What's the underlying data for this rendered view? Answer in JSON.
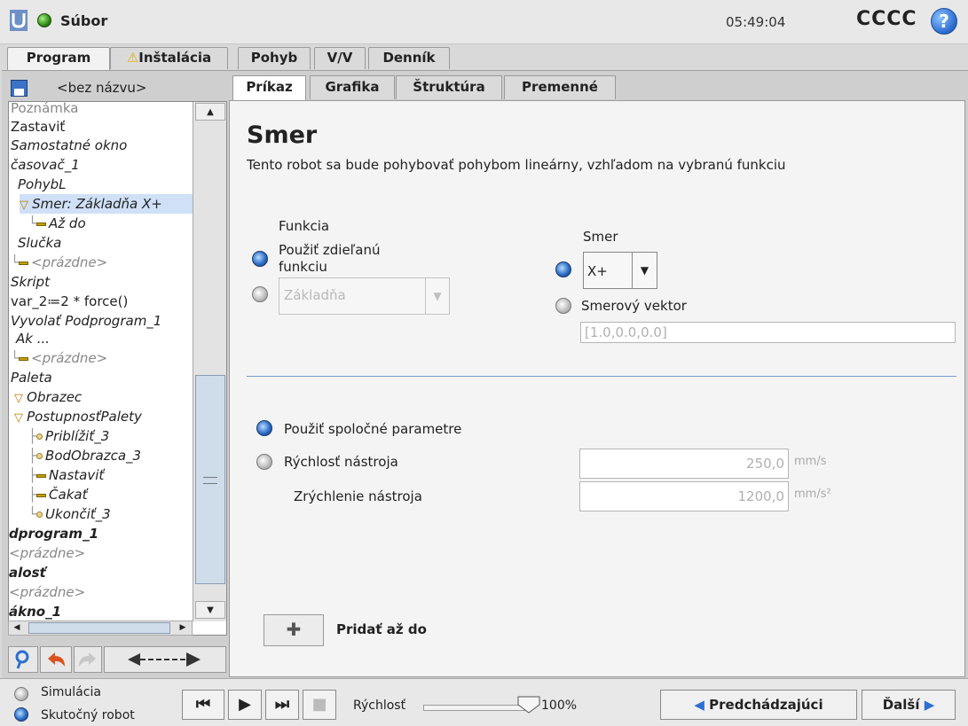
{
  "header": {
    "file_label": "Súbor",
    "clock": "05:49:04",
    "robot_name": "CCCC",
    "help_symbol": "?"
  },
  "main_tabs": [
    {
      "label": "Program",
      "active": true
    },
    {
      "label": "Inštalácia",
      "warning": "⚠"
    },
    {
      "label": "Pohyb"
    },
    {
      "label": "V/V"
    },
    {
      "label": "Denník"
    }
  ],
  "program": {
    "name": "<bez názvu>"
  },
  "tree": [
    "Poznámka",
    "Zastaviť",
    "Samostatné okno",
    "časovač_1",
    "PohybL",
    "Smer: Základňa X+",
    "Až do",
    "Slučka",
    "<prázdne>",
    "Skript",
    "var_2≔2 * force()",
    "Vyvolať Podprogram_1",
    "Ak ...",
    "<prázdne>",
    "Paleta",
    "Obrazec",
    "PostupnosťPalety",
    "Priblížiť_3",
    "BodObrazca_3",
    "Nastaviť",
    "Čakať",
    "Ukončiť_3",
    "dprogram_1",
    "<prázdne>",
    "alosť",
    "<prázdne>",
    "ákno_1"
  ],
  "sub_tabs": [
    {
      "label": "Príkaz",
      "active": true
    },
    {
      "label": "Grafika"
    },
    {
      "label": "Štruktúra"
    },
    {
      "label": "Premenné"
    }
  ],
  "panel": {
    "title": "Smer",
    "description": "Tento robot sa bude pohybovať pohybom lineárny, vzhľadom na vybranú funkciu",
    "feature_label": "Funkcia",
    "use_shared_feature": "Použiť zdieľanú funkciu",
    "feature_value": "Základňa",
    "direction_label": "Smer",
    "direction_value": "X+",
    "direction_vector_label": "Smerový vektor",
    "direction_vector_value": "[1.0,0.0,0.0]",
    "use_common_params": "Použiť spoločné parametre",
    "tool_speed_label": "Rýchlosť nástroja",
    "tool_speed_value": "250,0",
    "tool_speed_unit": "mm/s",
    "tool_accel_label": "Zrýchlenie nástroja",
    "tool_accel_value": "1200,0",
    "tool_accel_unit": "mm/s²",
    "add_until_label": "Pridať až do"
  },
  "footer": {
    "simulation_label": "Simulácia",
    "real_robot_label": "Skutočný robot",
    "speed_label": "Rýchlosť",
    "speed_value": "100%",
    "speed_fraction": 1.0,
    "prev_label": "Predchádzajúci",
    "next_label": "Ďalší"
  },
  "colors": {
    "accent": "#2f6fd1",
    "warning": "#e2b200"
  }
}
